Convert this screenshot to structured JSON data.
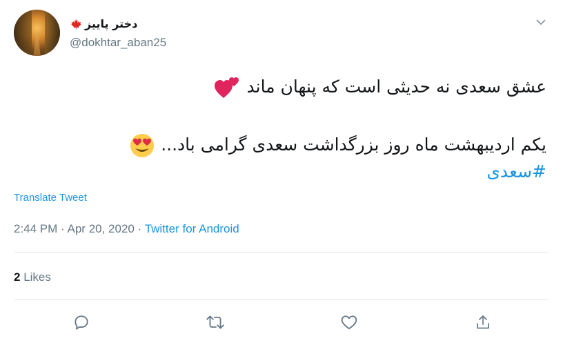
{
  "user": {
    "display_name": "دختر پاییز",
    "handle": "@dokhtar_aban25"
  },
  "tweet": {
    "line1": "عشق سعدی نه حدیثی است که پنهان ماند",
    "line2": "یکم اردیبهشت ماه روز بزرگداشت سعدی گرامی باد...",
    "hashtag": "#سعدی",
    "translate_label": "Translate Tweet",
    "time": "2:44 PM",
    "separator": "·",
    "date": "Apr 20, 2020",
    "source": "Twitter for Android"
  },
  "stats": {
    "likes_count": "2",
    "likes_label": "Likes"
  },
  "icons": {
    "flag": "maple-leaf-icon",
    "caret": "chevron-down-icon",
    "reply": "reply-icon",
    "retweet": "retweet-icon",
    "like": "heart-icon",
    "share": "share-icon"
  },
  "colors": {
    "link": "#1b95e0",
    "muted": "#657786",
    "text": "#14171a"
  }
}
